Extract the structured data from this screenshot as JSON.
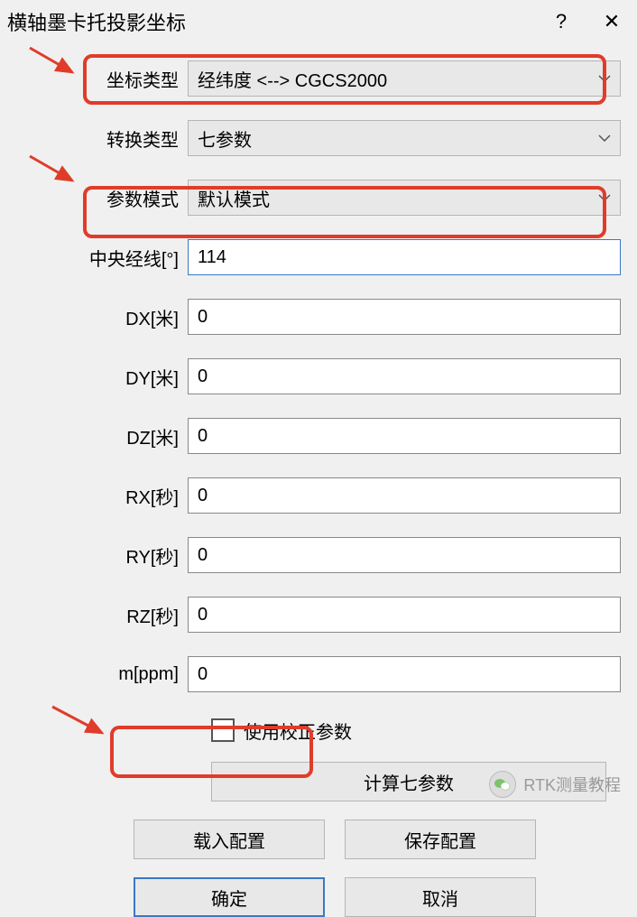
{
  "title": "横轴墨卡托投影坐标",
  "fields": {
    "coord_type": {
      "label": "坐标类型",
      "value": "经纬度 <--> CGCS2000",
      "kind": "select"
    },
    "trans_type": {
      "label": "转换类型",
      "value": "七参数",
      "kind": "select"
    },
    "param_mode": {
      "label": "参数模式",
      "value": "默认模式",
      "kind": "select"
    },
    "central_meridian": {
      "label": "中央经线[°]",
      "value": "114",
      "kind": "text",
      "focused": true
    },
    "dx": {
      "label": "DX[米]",
      "value": "0",
      "kind": "text"
    },
    "dy": {
      "label": "DY[米]",
      "value": "0",
      "kind": "text"
    },
    "dz": {
      "label": "DZ[米]",
      "value": "0",
      "kind": "text"
    },
    "rx": {
      "label": "RX[秒]",
      "value": "0",
      "kind": "text"
    },
    "ry": {
      "label": "RY[秒]",
      "value": "0",
      "kind": "text"
    },
    "rz": {
      "label": "RZ[秒]",
      "value": "0",
      "kind": "text"
    },
    "m": {
      "label": "m[ppm]",
      "value": "0",
      "kind": "text"
    }
  },
  "checkbox": {
    "label": "使用校正参数",
    "checked": false
  },
  "buttons": {
    "calc": "计算七参数",
    "load": "载入配置",
    "save": "保存配置",
    "ok": "确定",
    "cancel": "取消"
  },
  "watermark": "RTK测量教程"
}
